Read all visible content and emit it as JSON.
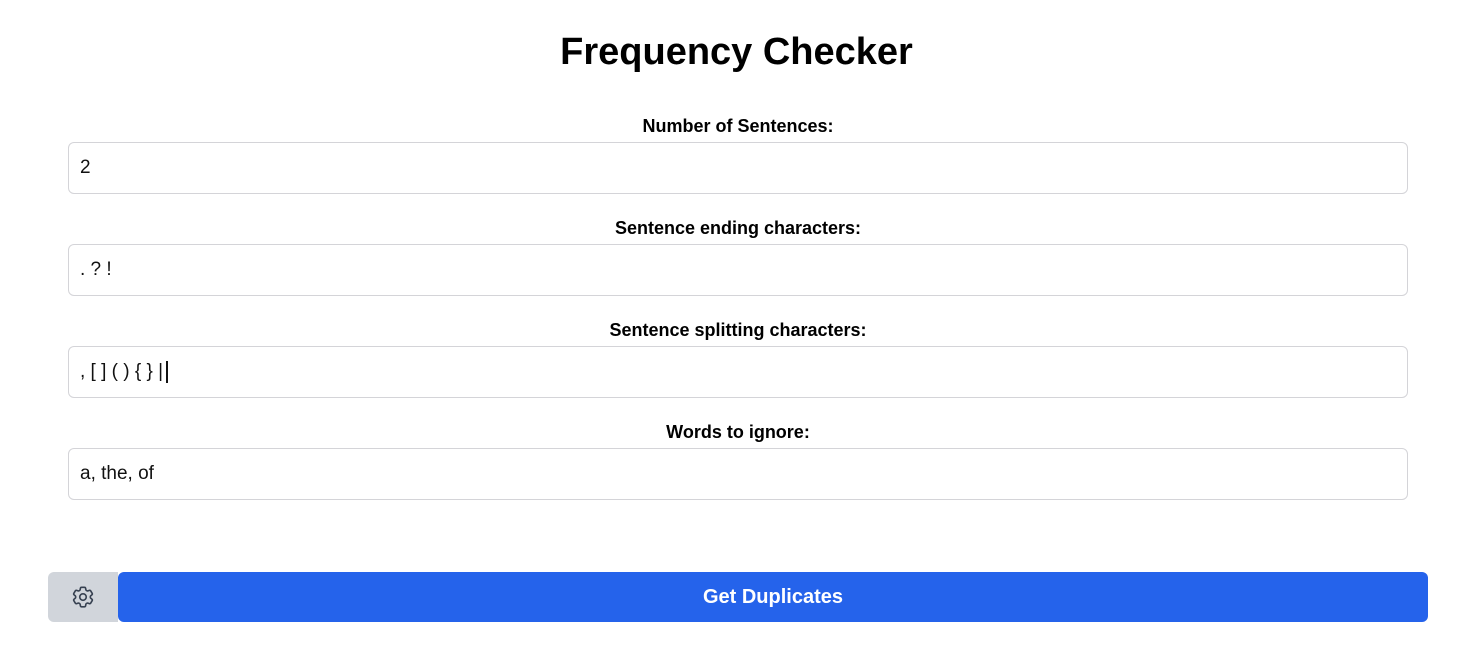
{
  "header": {
    "title": "Frequency Checker"
  },
  "form": {
    "sentences": {
      "label": "Number of Sentences:",
      "value": "2"
    },
    "ending_chars": {
      "label": "Sentence ending characters:",
      "value": ". ? !"
    },
    "splitting_chars": {
      "label": "Sentence splitting characters:",
      "value": ", [ ] ( ) { } |"
    },
    "ignore_words": {
      "label": "Words to ignore:",
      "value": "a, the, of"
    }
  },
  "actions": {
    "settings_icon": "gear-icon",
    "primary_label": "Get Duplicates"
  },
  "colors": {
    "primary": "#2563eb",
    "secondary": "#d1d5db",
    "input_border": "#d4d4d8"
  }
}
